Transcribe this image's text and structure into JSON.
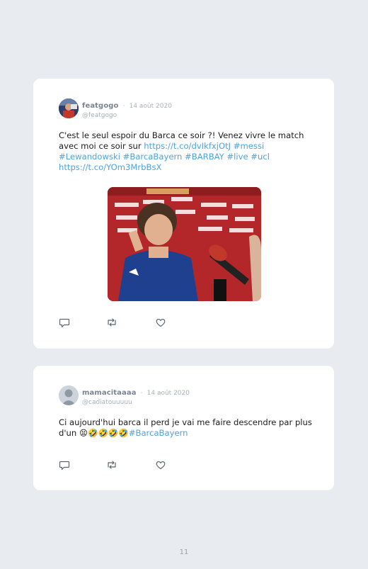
{
  "tweets": [
    {
      "username": "featgogo",
      "separator": "·",
      "date": "14 août 2020",
      "handle": "@featgogo",
      "text_plain": "C'est le seul espoir du Barca ce soir ?! Venez vivre le match avec moi ce soir sur ",
      "link_url": "https://t.co/dvIkfxjOtJ",
      "hashtags_1": " #messi #Lewandowski #BarcaBayern #BARBAY #live #ucl ",
      "link_url_2": "https://t.co/YOm3MrbBsX",
      "media_caption": "",
      "media_description_icon": "video-thumbnail"
    },
    {
      "username": "mamacitaaaa",
      "separator": "·",
      "date": "14 août 2020",
      "handle": "@cadiatouuuuu",
      "text_plain": "Ci aujourd'hui barca il perd je vai me faire descendre par plus d'un ",
      "emojis": "😫🤣🤣🤣🤣",
      "hashtag": "#BarcaBayern"
    }
  ],
  "page_number": "11",
  "colors": {
    "background": "#e8ebef",
    "card": "#ffffff",
    "link": "#4da3df",
    "muted": "#a9b1b8"
  },
  "icons": {
    "reply": "reply-icon",
    "retweet": "retweet-icon",
    "like": "heart-icon"
  }
}
